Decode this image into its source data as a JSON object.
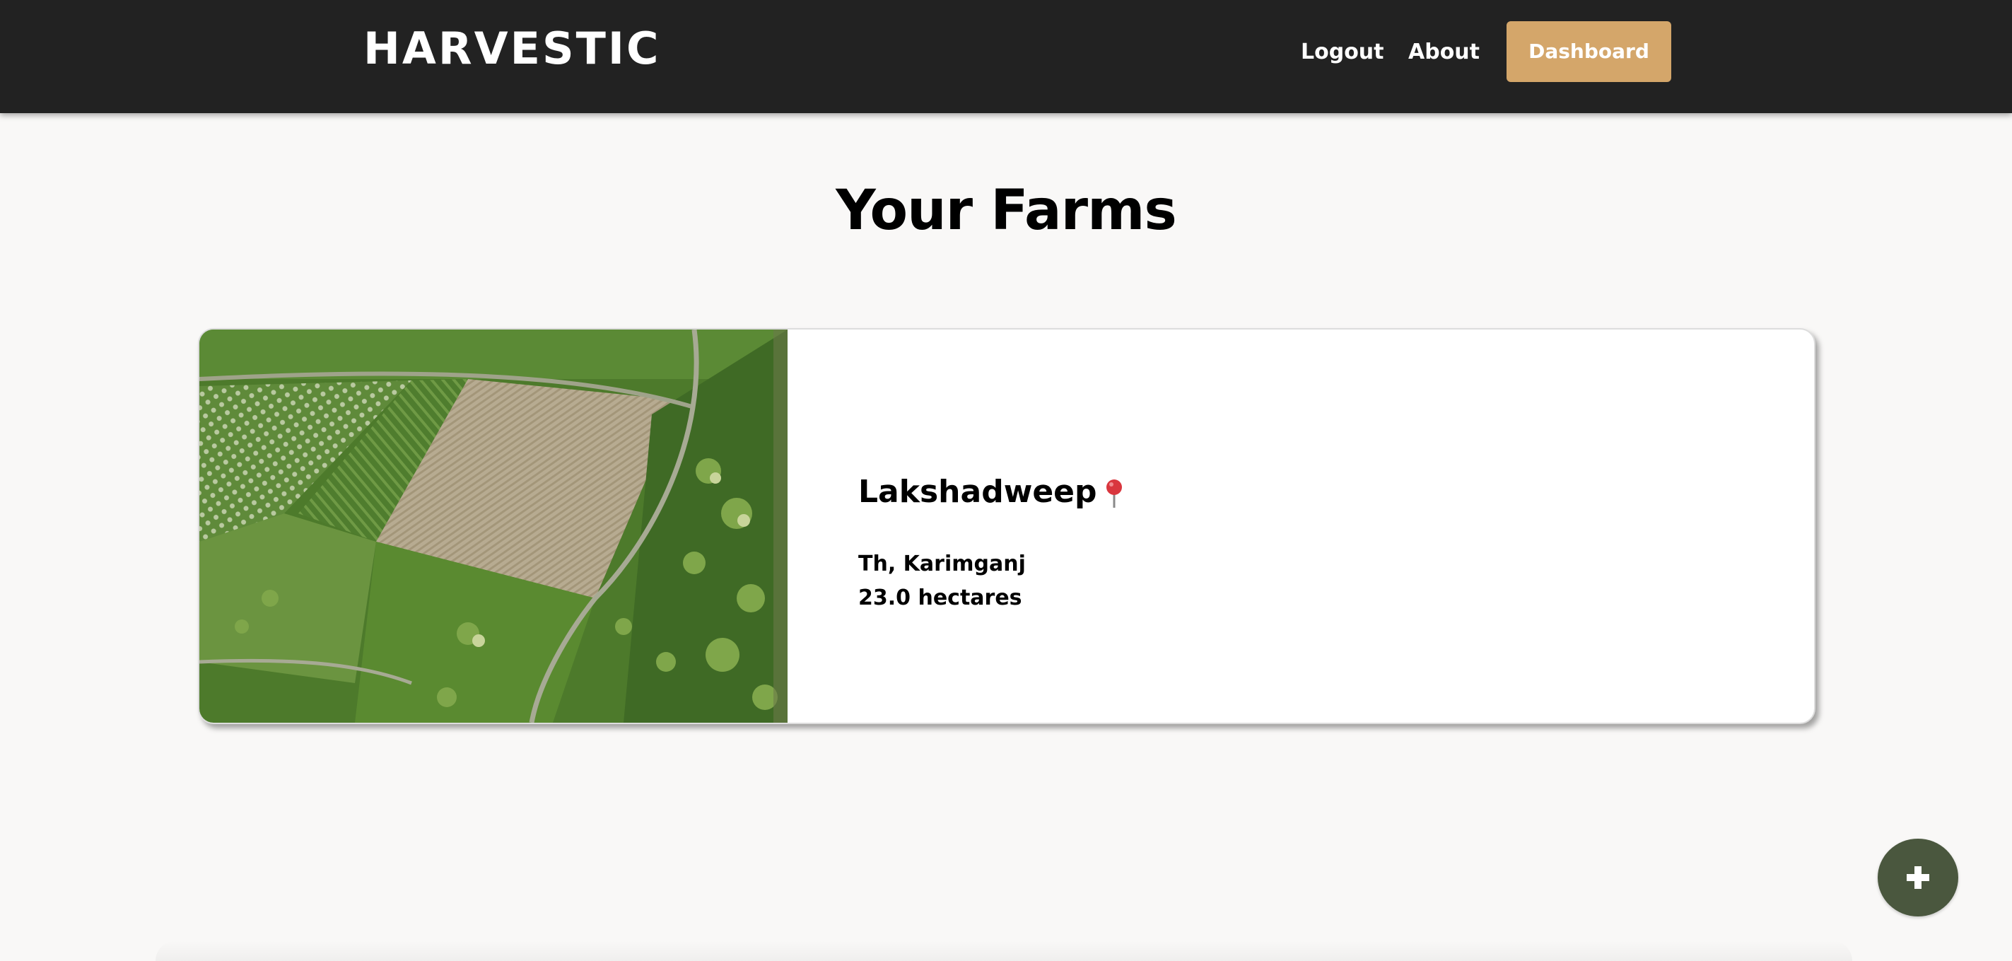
{
  "brand": {
    "logo_text": "HARVESTIC"
  },
  "nav": {
    "logout_label": "Logout",
    "about_label": "About",
    "dashboard_label": "Dashboard"
  },
  "colors": {
    "navbar_bg": "#222222",
    "accent": "#d4a66a",
    "page_bg": "#f9f8f7",
    "fab_bg": "#4a573e"
  },
  "main": {
    "title": "Your Farms",
    "farms": [
      {
        "name": "Lakshadweep",
        "location_icon": "map-pin-icon",
        "location": "Th, Karimganj",
        "area": "23.0 hectares",
        "image": "aerial-farm-fields-photo"
      }
    ]
  },
  "fab": {
    "icon": "plus-icon"
  }
}
